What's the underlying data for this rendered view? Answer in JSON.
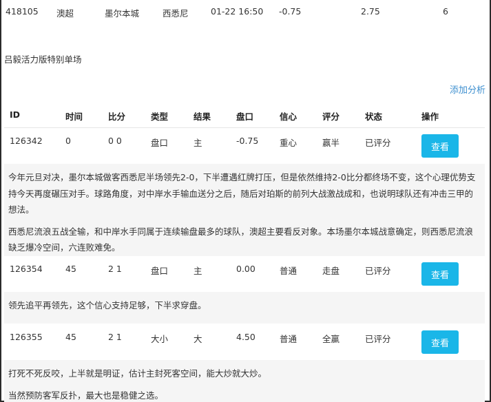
{
  "top_match": {
    "id": "418105",
    "league": "澳超",
    "home": "墨尔本城",
    "away": "西悉尼",
    "time": "01-22 16:50",
    "handicap": "-0.75",
    "odds": "2.75",
    "count": "6"
  },
  "section_title": "吕毅活力版特别单场",
  "add_analysis_label": "添加分析",
  "table": {
    "headers": [
      "ID",
      "时间",
      "比分",
      "类型",
      "结果",
      "盘口",
      "信心",
      "评分",
      "状态",
      "操作"
    ],
    "rows": [
      {
        "id": "126342",
        "time": "0",
        "score": "0 0",
        "type": "盘口",
        "result": "主",
        "handicap": "-0.75",
        "confidence": "重心",
        "rating": "赢半",
        "status": "已评分",
        "action": "查看",
        "notes": [
          "今年元旦对决，墨尔本城做客西悉尼半场领先2-0，下半遭遇红牌打压，但是依然维持2-0比分都终场不变，这个心理优势支持今天再度碾压对手。球路角度，对中岸水手输血送分之后，随后对珀斯的前列大战激战成和，也说明球队还有冲击三甲的想法。",
          "西悉尼流浪五战全输，和中岸水手同属于连续输盘最多的球队，澳超主要看反对象。本场墨尔本城战意确定，则西悉尼流浪缺乏爆冷空间，六连败难免。"
        ]
      },
      {
        "id": "126354",
        "time": "45",
        "score": "2 1",
        "type": "盘口",
        "result": "主",
        "handicap": "0.00",
        "confidence": "普通",
        "rating": "走盘",
        "status": "已评分",
        "action": "查看",
        "notes": [
          "领先追平再领先，这个信心支持足够，下半求穿盘。"
        ]
      },
      {
        "id": "126355",
        "time": "45",
        "score": "2 1",
        "type": "大小",
        "result": "大",
        "handicap": "4.50",
        "confidence": "普通",
        "rating": "全赢",
        "status": "已评分",
        "action": "查看",
        "notes": [
          "打死不死反咬，上半就是明证，估计主封死客空间，能大炒就大炒。",
          "当然预防客军反扑，最大也是稳健之选。"
        ]
      }
    ]
  }
}
